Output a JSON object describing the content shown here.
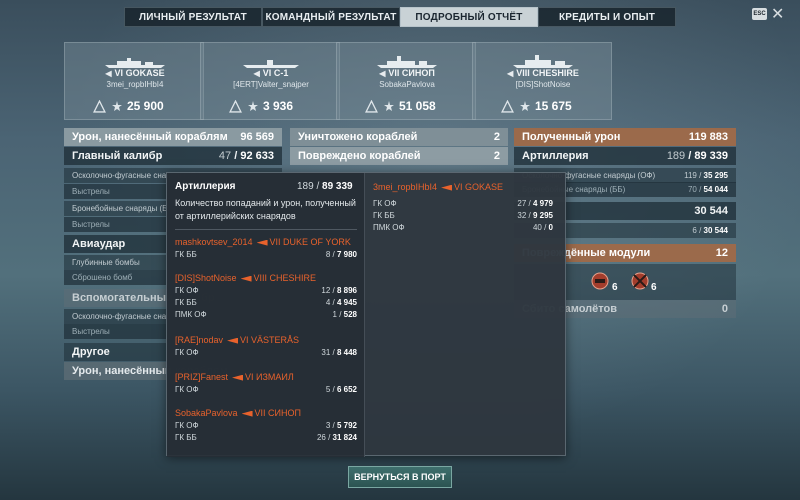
{
  "tabs": [
    "ЛИЧНЫЙ РЕЗУЛЬТАТ",
    "КОМАНДНЫЙ РЕЗУЛЬТАТ",
    "ПОДРОБНЫЙ ОТЧЁТ",
    "КРЕДИТЫ И ОПЫТ"
  ],
  "esc_label": "ESC",
  "ships": [
    {
      "tier": "VI",
      "name": "GOKASE",
      "player": "3mei_ropbIHbI4",
      "value": "25 900"
    },
    {
      "tier": "VI",
      "name": "C-1",
      "player": "[4ERT]Valter_snajper",
      "value": "3 936"
    },
    {
      "tier": "VII",
      "name": "СИНОП",
      "player": "SobakaPavlova",
      "value": "51 058"
    },
    {
      "tier": "VIII",
      "name": "CHESHIRE",
      "player": "[DIS]ShotNoise",
      "value": "15 675"
    }
  ],
  "left_panel": {
    "head_label": "Урон, нанесённый кораблям",
    "head_value": "96 569",
    "main_label": "Главный калибр",
    "main_a": "47",
    "main_b": "92 633",
    "he_label": "Осколочно-фугасные снаряды (ОФ)",
    "shots_label": "Выстрелы",
    "ap_label": "Бронебойные снаряды (ББ)",
    "shots2_label": "Выстрелы",
    "air_label": "Авиаудар",
    "depth_label": "Глубинные бомбы",
    "dropped_label": "Сброшено бомб",
    "secondary_label": "Вспомогательный калибр",
    "he2_label": "Осколочно-фугасные снаряды (ОФ)",
    "shots3_label": "Выстрелы",
    "other_label": "Другое",
    "bottom_label": "Урон, нанесённый кораблям"
  },
  "mid_panel": {
    "destroyed_label": "Уничтожено кораблей",
    "destroyed_value": "2",
    "damaged_label": "Повреждено кораблей",
    "damaged_value": "2"
  },
  "right_panel": {
    "head_label": "Полученный урон",
    "head_value": "119 883",
    "art_label": "Артиллерия",
    "art_a": "189",
    "art_b": "89 339",
    "he_label": "Осколочно-фугасные снаряды (ОФ)",
    "he_a": "119",
    "he_b": "35 295",
    "ap_label": "Бронебойные снаряды (ББ)",
    "ap_a": "70",
    "ap_b": "54 044",
    "val1": "30 544",
    "val2_a": "6",
    "val2_b": "30 544",
    "modules_label": "Повреждённые модули",
    "modules_value": "12",
    "mod1_count": "6",
    "mod2_count": "6",
    "planes_label": "Сбито самолётов",
    "planes_value": "0"
  },
  "tooltip": {
    "title": "Артиллерия",
    "total_a": "189",
    "total_b": "89 339",
    "desc": "Количество попаданий и урон, полученный от артиллерийских снарядов",
    "enemies": [
      {
        "player": "mashkovtsev_2014",
        "ship": "VII DUKE OF YORK",
        "rows": [
          {
            "label": "ГК ББ",
            "a": "8",
            "b": "7 980"
          }
        ]
      },
      {
        "player": "[DIS]ShotNoise",
        "ship": "VIII CHESHIRE",
        "rows": [
          {
            "label": "ГК ОФ",
            "a": "12",
            "b": "8 896"
          },
          {
            "label": "ГК ББ",
            "a": "4",
            "b": "4 945"
          },
          {
            "label": "ПМК ОФ",
            "a": "1",
            "b": "528"
          }
        ]
      },
      {
        "player": "[RAE]nodav",
        "ship": "VI VÄSTERÅS",
        "rows": [
          {
            "label": "ГК ОФ",
            "a": "31",
            "b": "8 448"
          }
        ]
      },
      {
        "player": "[PRIZ]Fanest",
        "ship": "VI ИЗМАИЛ",
        "rows": [
          {
            "label": "ГК ОФ",
            "a": "5",
            "b": "6 652"
          }
        ]
      },
      {
        "player": "SobakaPavlova",
        "ship": "VII СИНОП",
        "rows": [
          {
            "label": "ГК ОФ",
            "a": "3",
            "b": "5 792"
          },
          {
            "label": "ГК ББ",
            "a": "26",
            "b": "31 824"
          }
        ]
      }
    ],
    "right_enemy": {
      "player": "3mei_ropbIHbI4",
      "ship": "VI GOKASE",
      "rows": [
        {
          "label": "ГК ОФ",
          "a": "27",
          "b": "4 979"
        },
        {
          "label": "ГК ББ",
          "a": "32",
          "b": "9 295"
        },
        {
          "label": "ПМК ОФ",
          "a": "40",
          "b": "0"
        }
      ]
    }
  },
  "return_label": "ВЕРНУТЬСЯ В ПОРТ",
  "colors": {
    "enemy_red": "#e8622c",
    "orange_header": "#9b6a4b",
    "accent_teal": "#3e6f6d"
  }
}
